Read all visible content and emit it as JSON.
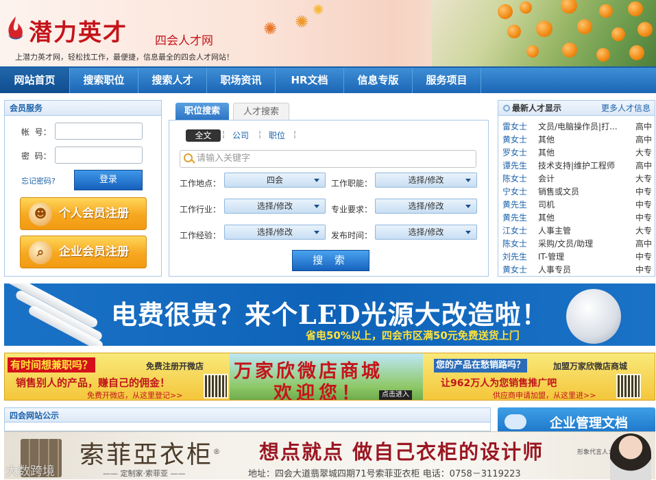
{
  "header": {
    "logo_text": "潜力英才",
    "logo_sub": "四会人才网",
    "slogan": "上潜力英才网，轻松找工作，最便捷，信息最全的四会人才网站！"
  },
  "nav": {
    "items": [
      {
        "label": "网站首页",
        "active": true
      },
      {
        "label": "搜索职位"
      },
      {
        "label": "搜索人才"
      },
      {
        "label": "职场资讯"
      },
      {
        "label": "HR文档"
      },
      {
        "label": "信息专版"
      },
      {
        "label": "服务项目"
      }
    ]
  },
  "member": {
    "title": "会员服务",
    "account_label": "帐  号：",
    "password_label": "密  码：",
    "forgot": "忘记密码?",
    "login": "登录",
    "personal_register": "个人会员注册",
    "company_register": "企业会员注册"
  },
  "search": {
    "tab_jobs": "职位搜索",
    "tab_talent": "人才搜索",
    "type_all": "全文",
    "type_company": "公司",
    "type_job": "职位",
    "keyword_placeholder": "请输入关键字",
    "fields": {
      "location_label": "工作地点：",
      "location_value": "四会",
      "function_label": "工作职能：",
      "function_value": "选择/修改",
      "industry_label": "工作行业：",
      "industry_value": "选择/修改",
      "major_label": "专业要求：",
      "major_value": "选择/修改",
      "experience_label": "工作经验：",
      "experience_value": "选择/修改",
      "published_label": "发布时间：",
      "published_value": "选择/修改"
    },
    "button": "搜 索"
  },
  "talent": {
    "title": "最新人才显示",
    "more": "更多人才信息",
    "rows": [
      {
        "name": "雷女士",
        "job": "文员/电脑操作员|打...",
        "edu": "高中"
      },
      {
        "name": "黄女士",
        "job": "其他",
        "edu": "高中"
      },
      {
        "name": "罗女士",
        "job": "其他",
        "edu": "大专"
      },
      {
        "name": "谭先生",
        "job": "技术支持|维护工程师",
        "edu": "高中"
      },
      {
        "name": "陈女士",
        "job": "会计",
        "edu": "大专"
      },
      {
        "name": "宁女士",
        "job": "销售或文员",
        "edu": "中专"
      },
      {
        "name": "黄先生",
        "job": "司机",
        "edu": "中专"
      },
      {
        "name": "黄先生",
        "job": "其他",
        "edu": "中专"
      },
      {
        "name": "江女士",
        "job": "人事主管",
        "edu": "大专"
      },
      {
        "name": "陈女士",
        "job": "采购/文员/助理",
        "edu": "高中"
      },
      {
        "name": "刘先生",
        "job": "IT-管理",
        "edu": "中专"
      },
      {
        "name": "黄女士",
        "job": "人事专员",
        "edu": "中专"
      }
    ]
  },
  "banner_led": {
    "main": "电费很贵？来个LED光源大改造啦！",
    "sub": "省电50%以上，四会市区满50元免费送货上门"
  },
  "banner_shop": {
    "left_title": "有时间想兼职吗？",
    "left_register": "免费注册开微店",
    "left_line": "销售别人的产品，赚自己的佣金！",
    "left_small": "免费开微店，从这里登记>>",
    "mid_title": "万家欣微店商城",
    "mid_welcome": "欢迎您！",
    "mid_button": "点击进入",
    "right_title": "您的产品在愁销路吗？",
    "right_join": "加盟万家欣微店商城",
    "right_line": "让962万人为您销售推广吧",
    "right_small": "供应商申请加盟，从这里进>>"
  },
  "notice": {
    "title": "四会网站公示"
  },
  "enterprise": {
    "label": "企业管理文档"
  },
  "banner_cabinet": {
    "brand": "索菲亞衣柜",
    "reg_mark": "®",
    "sub": "—— 定制家·索菲亚 ——",
    "slogan": "想点就点  做自己衣柜的设计师",
    "address": "地址：四会大道翡翠城四期71号索菲亚衣柜    电话：0758－3119223",
    "sign": "形象代言人：舒畅"
  },
  "watermark": "大数跨境"
}
